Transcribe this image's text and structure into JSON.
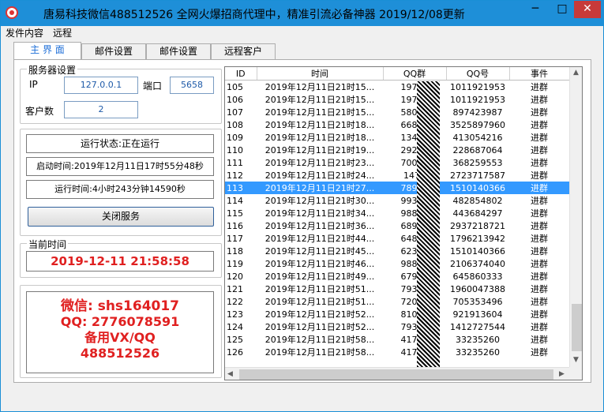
{
  "window": {
    "title": "唐易科技微信488512526   全网火爆招商代理中，精准引流必备神器   2019/12/08更新"
  },
  "menu": [
    "发件内容",
    "远程"
  ],
  "tabs": [
    "主 界 面",
    "邮件设置",
    "邮件设置",
    "远程客户"
  ],
  "server_settings": {
    "title": "服务器设置",
    "ip_label": "IP",
    "ip_value": "127.0.0.1",
    "port_label": "端口",
    "port_value": "5658",
    "clients_label": "客户数",
    "clients_value": "2"
  },
  "status": {
    "running": "运行状态:正在运行",
    "start_time": "启动时间:2019年12月11日17时55分48秒",
    "uptime": "运行时间:4小时243分钟14590秒",
    "stop_button": "关闭服务"
  },
  "clock": {
    "title": "当前时间",
    "value": "2019-12-11  21:58:58"
  },
  "ad": {
    "line1": "微信: shs164017",
    "line2": "QQ: 2776078591",
    "line3": "备用VX/QQ",
    "line4": "488512526"
  },
  "grid": {
    "headers": [
      "ID",
      "时间",
      "QQ群",
      "QQ号",
      "事件"
    ],
    "selected_row_id": "113",
    "rows": [
      [
        "105",
        "2019年12月11日21时15...",
        "19763",
        "1011921953",
        "进群"
      ],
      [
        "106",
        "2019年12月11日21时15...",
        "19763",
        "1011921953",
        "进群"
      ],
      [
        "107",
        "2019年12月11日21时15...",
        "58077",
        "897423987",
        "进群"
      ],
      [
        "108",
        "2019年12月11日21时18...",
        "66838",
        "3525897960",
        "进群"
      ],
      [
        "109",
        "2019年12月11日21时18...",
        "13476",
        "413054216",
        "进群"
      ],
      [
        "110",
        "2019年12月11日21时19...",
        "29222",
        "228687064",
        "进群"
      ],
      [
        "111",
        "2019年12月11日21时23...",
        "70014",
        "368259553",
        "进群"
      ],
      [
        "112",
        "2019年12月11日21时24...",
        "1475",
        "2723717587",
        "进群"
      ],
      [
        "113",
        "2019年12月11日21时27...",
        "78983",
        "1510140366",
        "进群"
      ],
      [
        "114",
        "2019年12月11日21时30...",
        "99384",
        "482854802",
        "进群"
      ],
      [
        "115",
        "2019年12月11日21时34...",
        "98850",
        "443684297",
        "进群"
      ],
      [
        "116",
        "2019年12月11日21时36...",
        "68990",
        "2937218721",
        "进群"
      ],
      [
        "117",
        "2019年12月11日21时44...",
        "64877",
        "1796213942",
        "进群"
      ],
      [
        "118",
        "2019年12月11日21时45...",
        "62380",
        "1510140366",
        "进群"
      ],
      [
        "119",
        "2019年12月11日21时46...",
        "98850",
        "2106374040",
        "进群"
      ],
      [
        "120",
        "2019年12月11日21时49...",
        "67938",
        "645860333",
        "进群"
      ],
      [
        "121",
        "2019年12月11日21时51...",
        "79396",
        "1960047388",
        "进群"
      ],
      [
        "122",
        "2019年12月11日21时51...",
        "72040",
        "705353496",
        "进群"
      ],
      [
        "123",
        "2019年12月11日21时52...",
        "81084",
        "921913604",
        "进群"
      ],
      [
        "124",
        "2019年12月11日21时52...",
        "79396",
        "1412727544",
        "进群"
      ],
      [
        "125",
        "2019年12月11日21时58...",
        "41789",
        "33235260",
        "进群"
      ],
      [
        "126",
        "2019年12月11日21时58...",
        "41789",
        "33235260",
        "进群"
      ]
    ]
  },
  "colors": {
    "titlebar": "#1e8fd8",
    "selection": "#3399ff",
    "ad_text": "#e02020"
  }
}
